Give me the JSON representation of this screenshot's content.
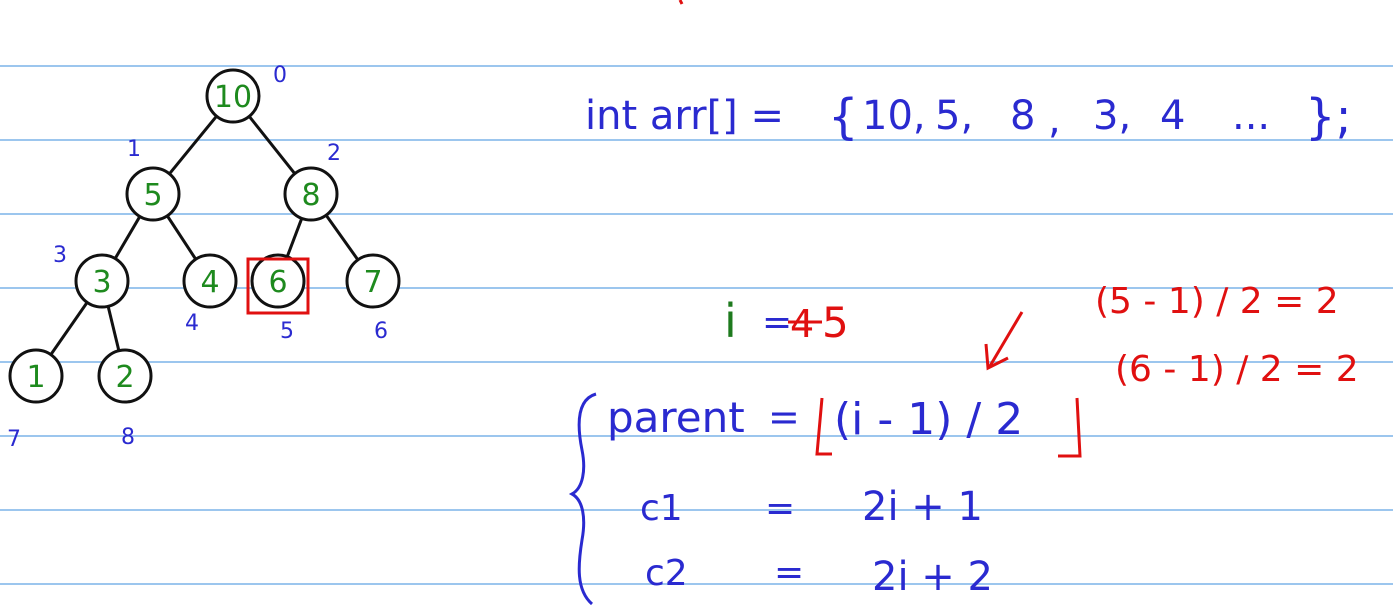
{
  "tree": {
    "nodes": [
      {
        "value": "10",
        "index": "0"
      },
      {
        "value": "5",
        "index": "1"
      },
      {
        "value": "8",
        "index": "2"
      },
      {
        "value": "3",
        "index": "3"
      },
      {
        "value": "4",
        "index": "4"
      },
      {
        "value": "6",
        "index": "5"
      },
      {
        "value": "7",
        "index": "6"
      },
      {
        "value": "1",
        "index": "7"
      },
      {
        "value": "2",
        "index": "8"
      }
    ],
    "edges": [
      [
        0,
        1
      ],
      [
        0,
        2
      ],
      [
        1,
        3
      ],
      [
        1,
        4
      ],
      [
        2,
        5
      ],
      [
        2,
        6
      ],
      [
        3,
        7
      ],
      [
        3,
        8
      ]
    ],
    "highlighted_index": 5
  },
  "array_decl": {
    "prefix": "int arr[] =",
    "open_brace": "{",
    "items": [
      "10,",
      "5,",
      "8",
      ",",
      "3,",
      "4",
      "..."
    ],
    "close": "};"
  },
  "i_line": {
    "label": "i",
    "equals": "=",
    "scratched_value": "4",
    "value": "5"
  },
  "formulas": {
    "parent": {
      "name": "parent",
      "equals": "=",
      "expr": "(i - 1) / 2"
    },
    "c1": {
      "name": "c1",
      "equals": "=",
      "expr": "2i + 1"
    },
    "c2": {
      "name": "c2",
      "equals": "=",
      "expr": "2i + 2"
    }
  },
  "calculations": [
    "(5 - 1) / 2 = 2",
    "(6 - 1) / 2 = 2"
  ],
  "colors": {
    "ruled_line": "#9cc6ee",
    "blue_ink": "#2a2ad0",
    "green_ink": "#1e8a1e",
    "red_ink": "#e01010",
    "black_ink": "#111111"
  }
}
